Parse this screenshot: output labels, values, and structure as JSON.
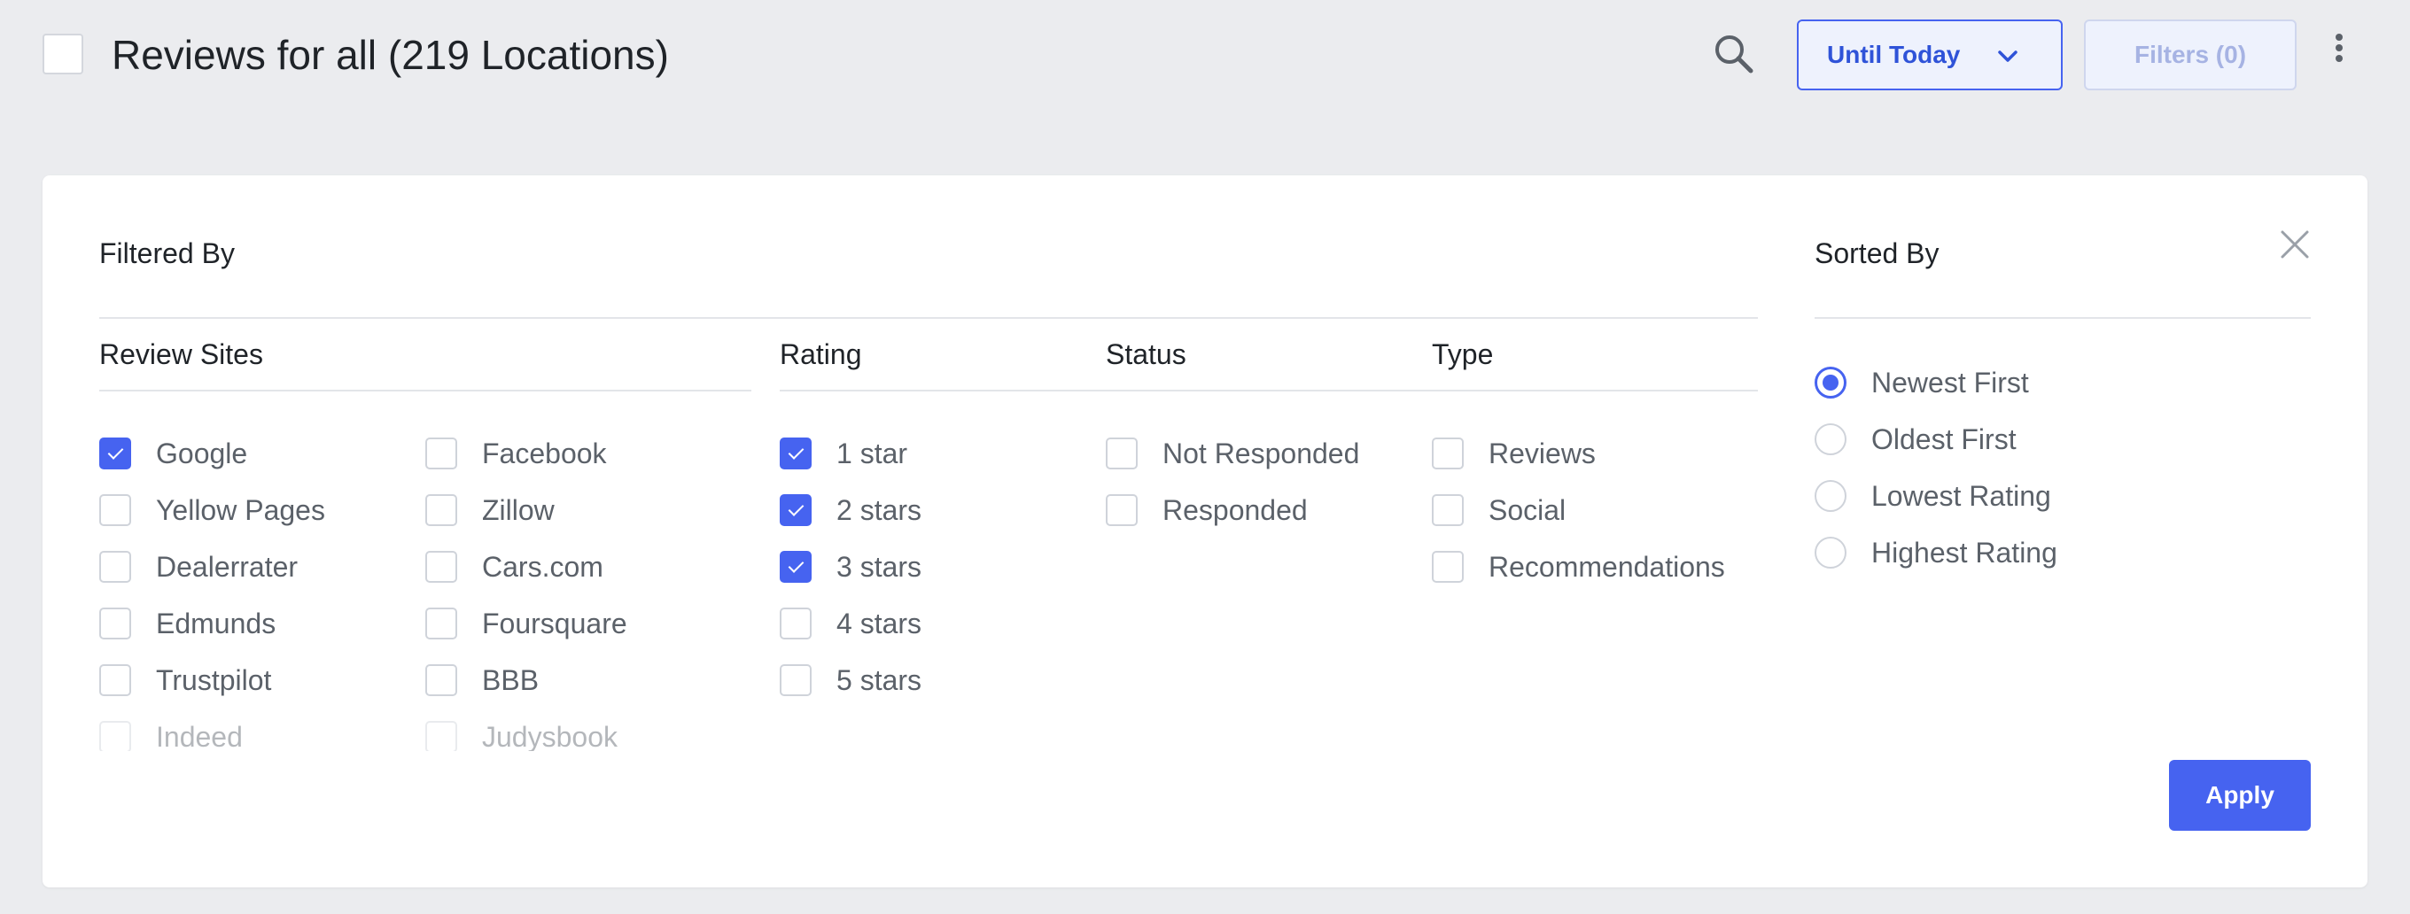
{
  "header": {
    "title": "Reviews for all (219 Locations)",
    "date_range_label": "Until Today",
    "filters_label": "Filters (0)"
  },
  "panel": {
    "filtered_by_label": "Filtered By",
    "sorted_by_label": "Sorted By",
    "apply_label": "Apply",
    "columns": {
      "review_sites": "Review Sites",
      "rating": "Rating",
      "status": "Status",
      "type": "Type"
    },
    "review_sites_left": [
      {
        "label": "Google",
        "checked": true
      },
      {
        "label": "Yellow Pages",
        "checked": false
      },
      {
        "label": "Dealerrater",
        "checked": false
      },
      {
        "label": "Edmunds",
        "checked": false
      },
      {
        "label": "Trustpilot",
        "checked": false
      },
      {
        "label": "Indeed",
        "checked": false
      }
    ],
    "review_sites_right": [
      {
        "label": "Facebook",
        "checked": false
      },
      {
        "label": "Zillow",
        "checked": false
      },
      {
        "label": "Cars.com",
        "checked": false
      },
      {
        "label": "Foursquare",
        "checked": false
      },
      {
        "label": "BBB",
        "checked": false
      },
      {
        "label": "Judysbook",
        "checked": false
      }
    ],
    "rating": [
      {
        "label": "1 star",
        "checked": true
      },
      {
        "label": "2 stars",
        "checked": true
      },
      {
        "label": "3 stars",
        "checked": true
      },
      {
        "label": "4 stars",
        "checked": false
      },
      {
        "label": "5 stars",
        "checked": false
      }
    ],
    "status": [
      {
        "label": "Not Responded",
        "checked": false
      },
      {
        "label": "Responded",
        "checked": false
      }
    ],
    "type": [
      {
        "label": "Reviews",
        "checked": false
      },
      {
        "label": "Social",
        "checked": false
      },
      {
        "label": "Recommendations",
        "checked": false
      }
    ],
    "sort": [
      {
        "label": "Newest First",
        "selected": true
      },
      {
        "label": "Oldest First",
        "selected": false
      },
      {
        "label": "Lowest Rating",
        "selected": false
      },
      {
        "label": "Highest Rating",
        "selected": false
      }
    ]
  },
  "colors": {
    "accent": "#4663f0",
    "background": "#ebecef",
    "panel": "#ffffff"
  },
  "icons": {
    "search": "search-icon",
    "chevron": "chevron-down-icon",
    "more": "more-vertical-icon",
    "close": "close-icon"
  }
}
